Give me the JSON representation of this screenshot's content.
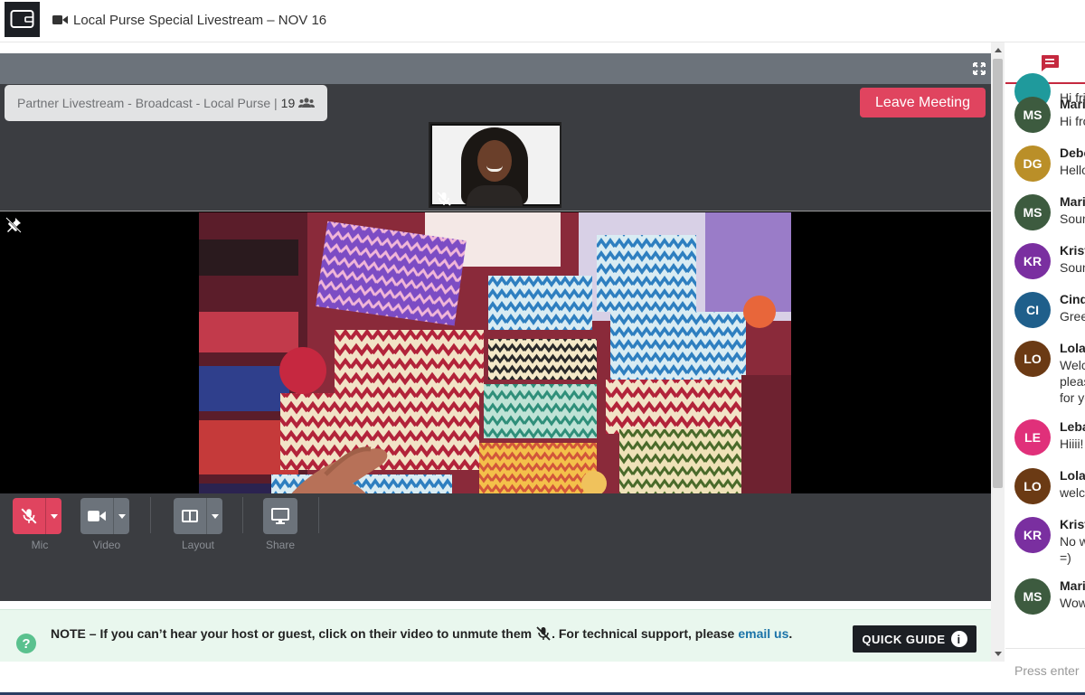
{
  "window": {
    "title": "Local Purse Special Livestream – NOV 16",
    "logo_icon": "wallet-icon",
    "title_icon": "video-camera-icon"
  },
  "stage": {
    "meeting_label": "Partner Livestream - Broadcast - Local Purse |",
    "participant_count": "19",
    "participant_icon": "users-icon",
    "leave_button": "Leave Meeting",
    "fullscreen_icon": "expand-icon",
    "thumbnail_muted_icon": "microphone-slash-icon",
    "pin_icon": "unpin-icon"
  },
  "controls": {
    "mic_label": "Mic",
    "video_label": "Video",
    "layout_label": "Layout",
    "share_label": "Share"
  },
  "note": {
    "text": "NOTE – If you can’t hear your host or guest, click on their video to unmute them",
    "text_after_icon": ". For technical support, please",
    "link": "email us",
    "suffix": ".",
    "guide_button": "QUICK GUIDE"
  },
  "chat": {
    "tab_icon": "chat-icon",
    "placeholder": "Press enter",
    "messages": [
      {
        "initials": "",
        "color": "#1f9a9c",
        "name": "",
        "lines": [
          "Hi fri"
        ]
      },
      {
        "initials": "MS",
        "color": "#3d5b3f",
        "name": "Mari",
        "lines": [
          "Hi fro"
        ]
      },
      {
        "initials": "DG",
        "color": "#ba8f28",
        "name": "Debo",
        "lines": [
          "Hello"
        ]
      },
      {
        "initials": "MS",
        "color": "#3d5b3f",
        "name": "Mari",
        "lines": [
          "Soun"
        ]
      },
      {
        "initials": "KR",
        "color": "#7a2fa0",
        "name": "Krist",
        "lines": [
          "Soun"
        ]
      },
      {
        "initials": "CI",
        "color": "#1f5f8b",
        "name": "Cind",
        "lines": [
          "Gree"
        ]
      },
      {
        "initials": "LO",
        "color": "#6b3a14",
        "name": "Lola",
        "lines": [
          "Welc",
          "pleas",
          "for yo"
        ]
      },
      {
        "initials": "LE",
        "color": "#e0307a",
        "name": "Leba",
        "lines": [
          "Hiiii!"
        ]
      },
      {
        "initials": "LO",
        "color": "#6b3a14",
        "name": "Lola",
        "lines": [
          "welc"
        ]
      },
      {
        "initials": "KR",
        "color": "#7a2fa0",
        "name": "Krist",
        "lines": [
          "No w",
          "=)"
        ]
      },
      {
        "initials": "MS",
        "color": "#3d5b3f",
        "name": "Mari",
        "lines": [
          "Wow"
        ]
      }
    ]
  }
}
